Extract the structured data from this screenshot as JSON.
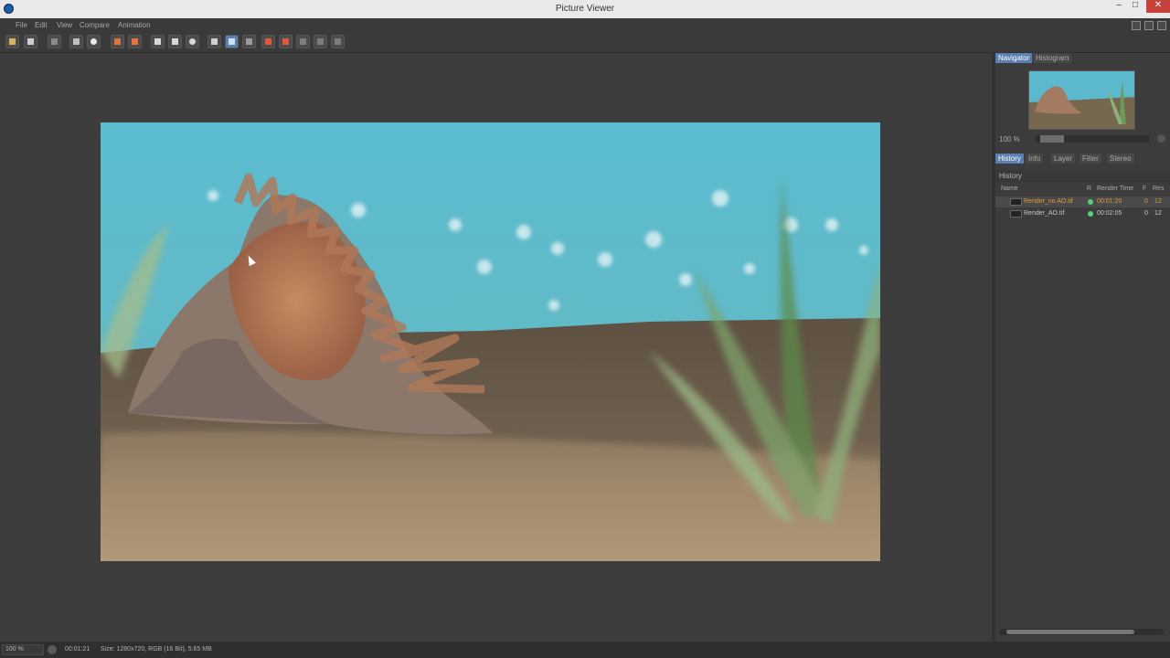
{
  "window": {
    "title": "Picture Viewer"
  },
  "menu": [
    "File",
    "Edit",
    "View",
    "Compare",
    "Animation"
  ],
  "panel": {
    "top_tabs": [
      "Navigator",
      "Histogram"
    ],
    "zoom": "100 %",
    "section_tabs": [
      "History",
      "Info",
      "Layer",
      "Filter",
      "Stereo"
    ],
    "history_title": "History",
    "columns": {
      "name": "Name",
      "r": "R",
      "render_time": "Render Time",
      "f": "F",
      "res": "Res"
    },
    "rows": [
      {
        "name": "Render_no AO.tif",
        "time": "00:01:20",
        "f": "0",
        "res": "12",
        "selected": true
      },
      {
        "name": "Render_AO.tif",
        "time": "00:02:05",
        "f": "0",
        "res": "12",
        "selected": false
      }
    ]
  },
  "status": {
    "zoom": "100 %",
    "time": "00:01:21",
    "info": "Size: 1280x720, RGB (16 Bit), 5.65 MB"
  },
  "colors": {
    "accent": "#5a7fb0",
    "selected_row_text": "#e09a3a",
    "status_dot": "#57d17a"
  },
  "icons": [
    "open-file-icon",
    "save-icon",
    "render-settings-icon",
    "zoom-fit-icon",
    "zoom-icon",
    "layer-icon",
    "compare-icon",
    "ab-compare-icon",
    "fullscreen-icon",
    "split-icon",
    "channel-icon"
  ]
}
